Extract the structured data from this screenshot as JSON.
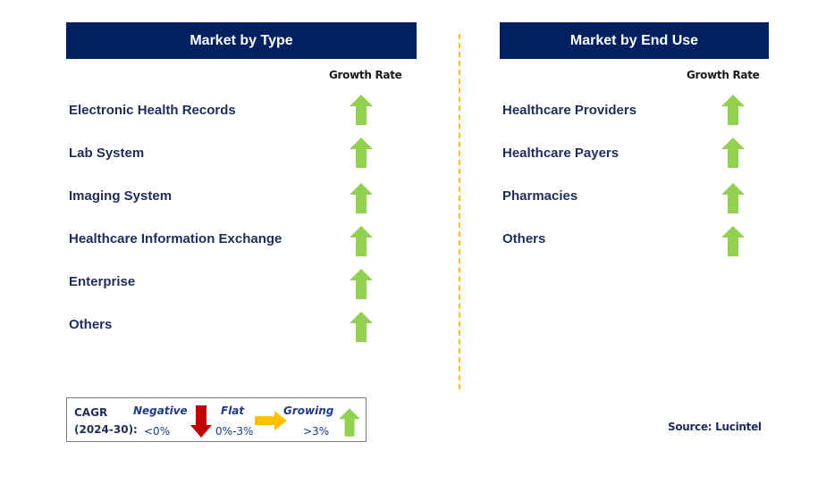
{
  "left_panel": {
    "title": "Market by Type",
    "growth_label": "Growth Rate",
    "items": [
      {
        "label": "Electronic Health Records",
        "trend": "growing"
      },
      {
        "label": "Lab System",
        "trend": "growing"
      },
      {
        "label": "Imaging System",
        "trend": "growing"
      },
      {
        "label": "Healthcare Information Exchange",
        "trend": "growing"
      },
      {
        "label": "Enterprise",
        "trend": "growing"
      },
      {
        "label": "Others",
        "trend": "growing"
      }
    ]
  },
  "right_panel": {
    "title": "Market by End Use",
    "growth_label": "Growth Rate",
    "items": [
      {
        "label": "Healthcare Providers",
        "trend": "growing"
      },
      {
        "label": "Healthcare Payers",
        "trend": "growing"
      },
      {
        "label": "Pharmacies",
        "trend": "growing"
      },
      {
        "label": "Others",
        "trend": "growing"
      }
    ]
  },
  "legend": {
    "cagr_label": "CAGR",
    "period": "(2024-30):",
    "negative": {
      "label": "Negative",
      "range": "<0%",
      "icon": "arrow-down-red-icon"
    },
    "flat": {
      "label": "Flat",
      "range": "0%-3%",
      "icon": "arrow-right-yellow-icon"
    },
    "growing": {
      "label": "Growing",
      "range": ">3%",
      "icon": "arrow-up-green-icon"
    }
  },
  "source": "Source: Lucintel",
  "colors": {
    "header_bg": "#002060",
    "growing": "#92d050",
    "flat": "#ffc000",
    "negative": "#c00000",
    "divider": "#ffc000"
  }
}
